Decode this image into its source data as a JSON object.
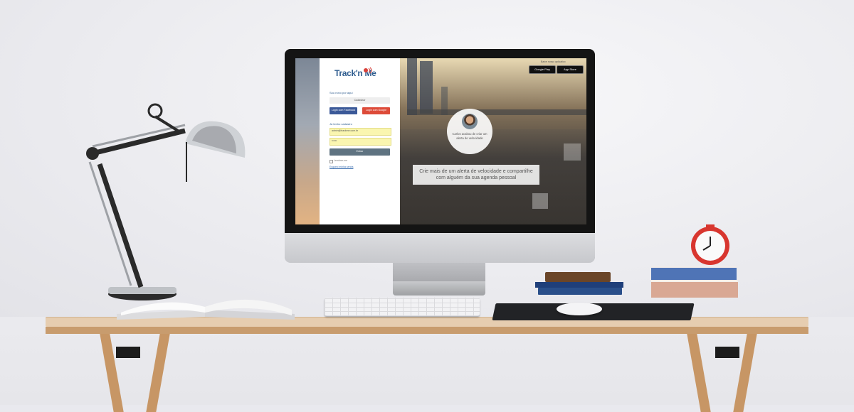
{
  "login": {
    "logo": "Track'n Me",
    "new_here": "Sou novo por aqui",
    "register_button": "Cadastrar",
    "facebook_button": "Login com Facebook",
    "google_button": "Login com Google",
    "already_registered": "Já tenho cadastro",
    "email_value": "admin@trackme.com.br",
    "password_value": "••••••",
    "login_button": "Entrar",
    "remember_me": "Lembrar-me",
    "forgot_password": "Esqueci minha senha"
  },
  "hero": {
    "download_label": "Baixe nosso aplicativo",
    "google_play": "Google Play",
    "app_store": "App Store",
    "notification": "Carlos acabou de criar um alerta de velocidade",
    "tagline_line1": "Crie mais de um alerta de velocidade e compartilhe",
    "tagline_line2": "com alguém da sua agenda pessoal"
  },
  "colors": {
    "brand_blue": "#2f5d8f",
    "brand_red": "#d8413a",
    "facebook": "#3b5998",
    "google": "#dd4b39",
    "login_button": "#5f7381",
    "input_highlight": "#faf6b0"
  }
}
